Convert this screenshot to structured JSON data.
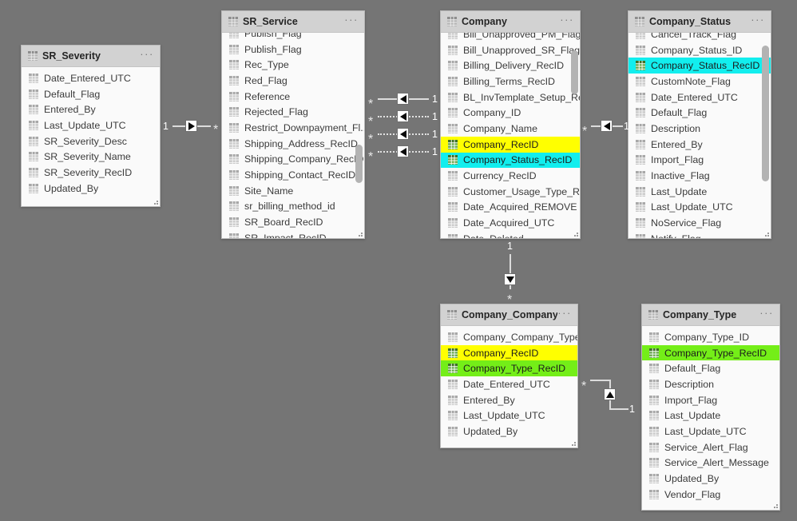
{
  "app": {
    "background_color": "#757575",
    "card_background": "#fafafa",
    "header_background": "#d2d2d2",
    "highlight_yellow": "#ffff00",
    "highlight_cyan": "#12eeee",
    "highlight_green": "#74ee18",
    "more_options_label": "···"
  },
  "tables": [
    {
      "id": "sr-severity",
      "title": "SR_Severity",
      "icon": "table-icon",
      "scrolled": false,
      "fields": [
        {
          "label": "Date_Entered_UTC",
          "highlight": "none"
        },
        {
          "label": "Default_Flag",
          "highlight": "none"
        },
        {
          "label": "Entered_By",
          "highlight": "none"
        },
        {
          "label": "Last_Update_UTC",
          "highlight": "none"
        },
        {
          "label": "SR_Severity_Desc",
          "highlight": "none"
        },
        {
          "label": "SR_Severity_Name",
          "highlight": "none"
        },
        {
          "label": "SR_Severity_RecID",
          "highlight": "none"
        },
        {
          "label": "Updated_By",
          "highlight": "none"
        }
      ]
    },
    {
      "id": "sr-service",
      "title": "SR_Service",
      "icon": "table-icon",
      "scrolled": true,
      "partial_top_field": "Publish_Flag",
      "fields": [
        {
          "label": "Publish_Flag",
          "highlight": "none"
        },
        {
          "label": "Rec_Type",
          "highlight": "none"
        },
        {
          "label": "Red_Flag",
          "highlight": "none"
        },
        {
          "label": "Reference",
          "highlight": "none"
        },
        {
          "label": "Rejected_Flag",
          "highlight": "none"
        },
        {
          "label": "Restrict_Downpayment_Fl...",
          "highlight": "none"
        },
        {
          "label": "Shipping_Address_RecID",
          "highlight": "none"
        },
        {
          "label": "Shipping_Company_RecID",
          "highlight": "none"
        },
        {
          "label": "Shipping_Contact_RecID",
          "highlight": "none"
        },
        {
          "label": "Site_Name",
          "highlight": "none"
        },
        {
          "label": "sr_billing_method_id",
          "highlight": "none"
        },
        {
          "label": "SR_Board_RecID",
          "highlight": "none"
        },
        {
          "label": "SR_Impact_RecID",
          "highlight": "none"
        }
      ]
    },
    {
      "id": "company",
      "title": "Company",
      "icon": "table-icon",
      "scrolled": true,
      "partial_top_field": "Bill_Unapproved_PM_Flag",
      "fields": [
        {
          "label": "Bill_Unapproved_SR_Flag",
          "highlight": "none"
        },
        {
          "label": "Billing_Delivery_RecID",
          "highlight": "none"
        },
        {
          "label": "Billing_Terms_RecID",
          "highlight": "none"
        },
        {
          "label": "BL_InvTemplate_Setup_Re...",
          "highlight": "none"
        },
        {
          "label": "Company_ID",
          "highlight": "none"
        },
        {
          "label": "Company_Name",
          "highlight": "none"
        },
        {
          "label": "Company_RecID",
          "highlight": "yellow"
        },
        {
          "label": "Company_Status_RecID",
          "highlight": "cyan"
        },
        {
          "label": "Currency_RecID",
          "highlight": "none"
        },
        {
          "label": "Customer_Usage_Type_R...",
          "highlight": "none"
        },
        {
          "label": "Date_Acquired_REMOVE",
          "highlight": "none"
        },
        {
          "label": "Date_Acquired_UTC",
          "highlight": "none"
        },
        {
          "label": "Date_Deleted",
          "highlight": "none"
        }
      ]
    },
    {
      "id": "company-status",
      "title": "Company_Status",
      "icon": "table-icon",
      "scrolled": true,
      "partial_top_field": "Cancel_Track_Flag",
      "fields": [
        {
          "label": "Company_Status_ID",
          "highlight": "none"
        },
        {
          "label": "Company_Status_RecID",
          "highlight": "cyan"
        },
        {
          "label": "CustomNote_Flag",
          "highlight": "none"
        },
        {
          "label": "Date_Entered_UTC",
          "highlight": "none"
        },
        {
          "label": "Default_Flag",
          "highlight": "none"
        },
        {
          "label": "Description",
          "highlight": "none"
        },
        {
          "label": "Entered_By",
          "highlight": "none"
        },
        {
          "label": "Import_Flag",
          "highlight": "none"
        },
        {
          "label": "Inactive_Flag",
          "highlight": "none"
        },
        {
          "label": "Last_Update",
          "highlight": "none"
        },
        {
          "label": "Last_Update_UTC",
          "highlight": "none"
        },
        {
          "label": "NoService_Flag",
          "highlight": "none"
        },
        {
          "label": "Notify_Flag",
          "highlight": "none"
        }
      ]
    },
    {
      "id": "company-company-type",
      "title": "Company_Company_...",
      "icon": "table-icon",
      "scrolled": false,
      "fields": [
        {
          "label": "Company_Company_Type...",
          "highlight": "none"
        },
        {
          "label": "Company_RecID",
          "highlight": "yellow"
        },
        {
          "label": "Company_Type_RecID",
          "highlight": "green"
        },
        {
          "label": "Date_Entered_UTC",
          "highlight": "none"
        },
        {
          "label": "Entered_By",
          "highlight": "none"
        },
        {
          "label": "Last_Update_UTC",
          "highlight": "none"
        },
        {
          "label": "Updated_By",
          "highlight": "none"
        }
      ]
    },
    {
      "id": "company-type",
      "title": "Company_Type",
      "icon": "table-icon",
      "scrolled": false,
      "fields": [
        {
          "label": "Company_Type_ID",
          "highlight": "none"
        },
        {
          "label": "Company_Type_RecID",
          "highlight": "green"
        },
        {
          "label": "Default_Flag",
          "highlight": "none"
        },
        {
          "label": "Description",
          "highlight": "none"
        },
        {
          "label": "Import_Flag",
          "highlight": "none"
        },
        {
          "label": "Last_Update",
          "highlight": "none"
        },
        {
          "label": "Last_Update_UTC",
          "highlight": "none"
        },
        {
          "label": "Service_Alert_Flag",
          "highlight": "none"
        },
        {
          "label": "Service_Alert_Message",
          "highlight": "none"
        },
        {
          "label": "Updated_By",
          "highlight": "none"
        },
        {
          "label": "Vendor_Flag",
          "highlight": "none"
        }
      ]
    }
  ],
  "relationships": [
    {
      "id": "rel-srseverity-srservice",
      "from_label": "1",
      "to_label": "*",
      "line": "solid",
      "direction": "right",
      "orientation": "horizontal"
    },
    {
      "id": "rel-srservice-company-1",
      "from_label": "*",
      "to_label": "1",
      "line": "solid",
      "direction": "left",
      "orientation": "horizontal"
    },
    {
      "id": "rel-srservice-company-2",
      "from_label": "*",
      "to_label": "1",
      "line": "dotted",
      "direction": "left",
      "orientation": "horizontal"
    },
    {
      "id": "rel-srservice-company-3",
      "from_label": "*",
      "to_label": "1",
      "line": "dotted",
      "direction": "left",
      "orientation": "horizontal"
    },
    {
      "id": "rel-srservice-company-4",
      "from_label": "*",
      "to_label": "1",
      "line": "dotted",
      "direction": "left",
      "orientation": "horizontal"
    },
    {
      "id": "rel-company-companystatus",
      "from_label": "*",
      "to_label": "1",
      "line": "solid",
      "direction": "left",
      "orientation": "horizontal"
    },
    {
      "id": "rel-company-bridge",
      "from_label": "1",
      "to_label": "*",
      "line": "solid",
      "direction": "down",
      "orientation": "vertical"
    },
    {
      "id": "rel-bridge-companytype",
      "from_label": "*",
      "to_label": "1",
      "line": "solid",
      "direction": "up",
      "orientation": "elbow"
    }
  ]
}
